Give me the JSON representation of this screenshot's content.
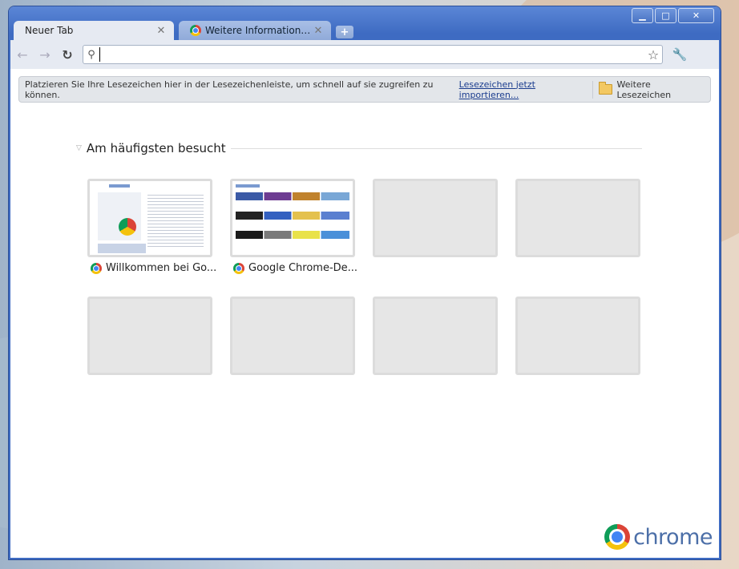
{
  "window": {
    "minimize_symbol": "▁",
    "maximize_symbol": "□",
    "close_symbol": "✕"
  },
  "tabs": [
    {
      "title": "Neuer Tab",
      "active": true
    },
    {
      "title": "Weitere Informationen übe...",
      "active": false
    }
  ],
  "toolbar": {
    "address_value": "",
    "back_icon": "back-arrow-icon",
    "forward_icon": "forward-arrow-icon"
  },
  "bookmark_bar": {
    "hint": "Platzieren Sie Ihre Lesezeichen hier in der Lesezeichenleiste, um schnell auf sie zugreifen zu können.",
    "import_link": "Lesezeichen jetzt importieren...",
    "other_bookmarks": "Weitere Lesezeichen"
  },
  "most_visited": {
    "title": "Am häufigsten besucht",
    "items": [
      {
        "title": "Willkommen bei Go..."
      },
      {
        "title": "Google Chrome-De..."
      }
    ]
  },
  "branding": {
    "word": "chrome"
  },
  "colors": {
    "window_frame": "#3e6bc2",
    "toolbar": "#e6eaf2",
    "link": "#1a3c8e",
    "thumb_empty": "#e6e6e6"
  }
}
